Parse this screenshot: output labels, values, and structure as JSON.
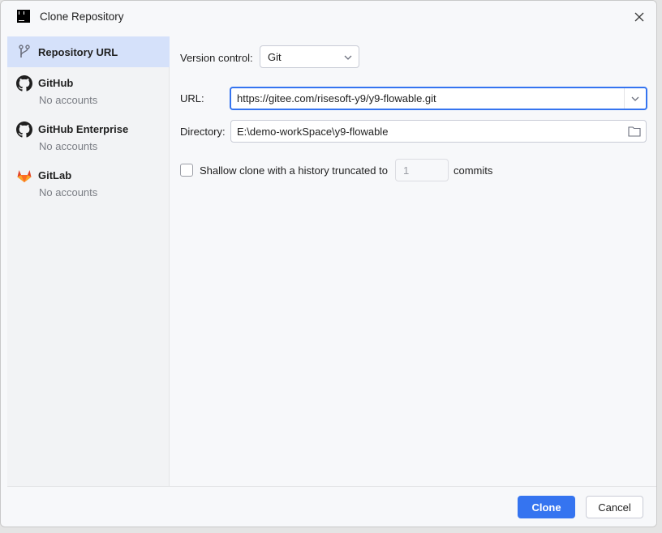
{
  "window": {
    "title": "Clone Repository"
  },
  "sidebar": {
    "items": [
      {
        "label": "Repository URL",
        "subtitle": ""
      },
      {
        "label": "GitHub",
        "subtitle": "No accounts"
      },
      {
        "label": "GitHub Enterprise",
        "subtitle": "No accounts"
      },
      {
        "label": "GitLab",
        "subtitle": "No accounts"
      }
    ]
  },
  "form": {
    "version_control_label": "Version control:",
    "version_control_value": "Git",
    "url_label": "URL:",
    "url_value": "https://gitee.com/risesoft-y9/y9-flowable.git",
    "directory_label": "Directory:",
    "directory_value": "E:\\demo-workSpace\\y9-flowable",
    "shallow_label": "Shallow clone with a history truncated to",
    "shallow_depth": "1",
    "shallow_suffix": "commits"
  },
  "footer": {
    "clone_label": "Clone",
    "cancel_label": "Cancel"
  },
  "colors": {
    "accent": "#3574f0",
    "selection": "#d5e1fa",
    "gitlab": "#e24329"
  },
  "icons": [
    "app-icon",
    "close-icon",
    "vcs-branch-icon",
    "github-icon",
    "gitlab-icon",
    "chevron-down-icon",
    "folder-icon"
  ]
}
